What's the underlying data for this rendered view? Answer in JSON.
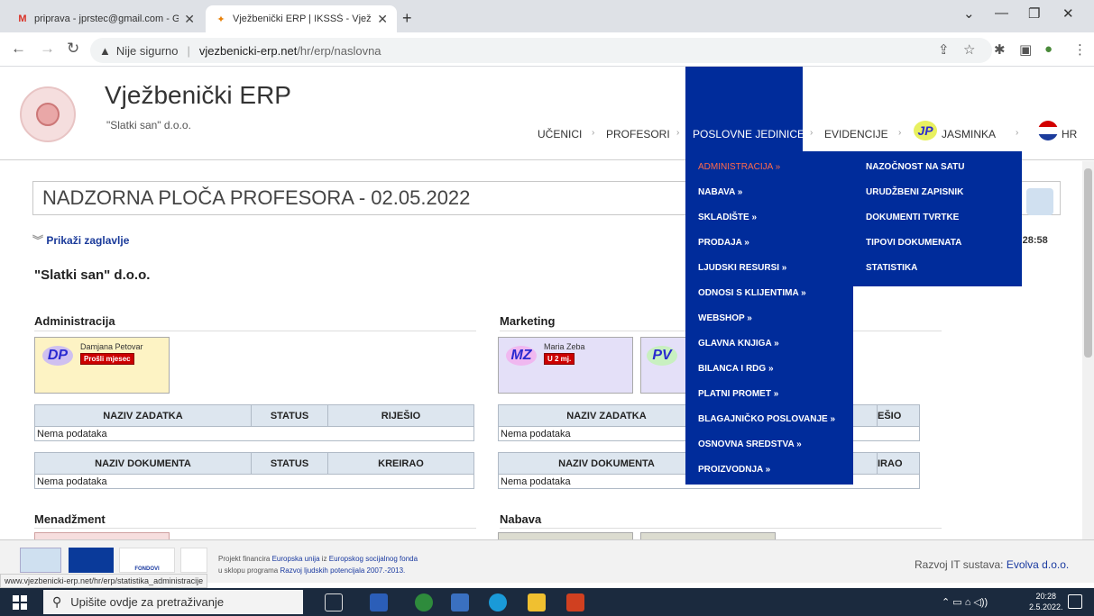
{
  "browser": {
    "tabs": [
      {
        "title": "priprava - jprstec@gmail.com - G",
        "favicon": "gmail-icon"
      },
      {
        "title": "Vježbenički ERP | IKSSŠ - Vježbe",
        "favicon": "erp-favicon"
      }
    ],
    "security_label": "Nije sigurno",
    "url_host": "vjezbenicki-erp.net",
    "url_path": "/hr/erp/naslovna"
  },
  "site": {
    "title": "Vježbenički ERP",
    "subtitle": "\"Slatki san\" d.o.o.",
    "nav": [
      "UČENICI",
      "PROFESORI",
      "POSLOVNE JEDINICE",
      "EVIDENCIJE",
      "JASMINKA",
      "HR"
    ],
    "user_initials": "JP"
  },
  "dashboard": {
    "title": "NADZORNA PLOČA PROFESORA - 02.05.2022",
    "show_header": "Prikaži zaglavlje",
    "company": "\"Slatki san\" d.o.o.",
    "time": ":28:58"
  },
  "sections": {
    "administracija": {
      "title": "Administracija",
      "user": {
        "initials": "DP",
        "name": "Damjana Petovar",
        "badge": "Prošli mjesec"
      }
    },
    "marketing": {
      "title": "Marketing",
      "user": {
        "initials": "MZ",
        "name": "Maria Zeba",
        "badge": "U 2 mj."
      },
      "user2": {
        "initials": "PV"
      }
    },
    "menadzment": {
      "title": "Menadžment"
    },
    "nabava": {
      "title": "Nabava"
    }
  },
  "tables": {
    "tasks_headers": [
      "NAZIV ZADATKA",
      "STATUS",
      "RIJEŠIO"
    ],
    "docs_headers": [
      "NAZIV DOKUMENTA",
      "STATUS",
      "KREIRAO"
    ],
    "tasks_headers_partial": [
      "NAZIV ZADATKA",
      "EŠIO"
    ],
    "docs_headers_partial": [
      "NAZIV DOKUMENTA",
      "IRAO"
    ],
    "empty": "Nema podataka"
  },
  "menu": {
    "items": [
      "ADMINISTRACIJA »",
      "NABAVA »",
      "SKLADIŠTE »",
      "PRODAJA »",
      "LJUDSKI RESURSI »",
      "ODNOSI S KLIJENTIMA »",
      "WEBSHOP »",
      "GLAVNA KNJIGA »",
      "BILANCA I RDG »",
      "PLATNI PROMET »",
      "BLAGAJNIČKO POSLOVANJE »",
      "OSNOVNA SREDSTVA »",
      "PROIZVODNJA »"
    ],
    "submenu": [
      "NAZOČNOST NA SATU",
      "URUDŽBENI ZAPISNIK",
      "DOKUMENTI TVRTKE",
      "TIPOVI DOKUMENATA",
      "STATISTIKA"
    ]
  },
  "footer": {
    "line1_pre": "Projekt financira ",
    "line1_eu": "Europska unija",
    "line1_mid": " iz ",
    "line1_fund": "Europskog socijalnog fonda",
    "line2_pre": "u sklopu programa ",
    "line2_prog": "Razvoj ljudskih potencijala 2007.-2013.",
    "fondovi": "FONDOVI",
    "status_url": "www.vjezbenicki-erp.net/hr/erp/statistika_administracije",
    "dev_label": "Razvoj IT sustava: ",
    "dev_link": "Evolva d.o.o."
  },
  "taskbar": {
    "search_placeholder": "Upišite ovdje za pretraživanje",
    "time": "20:28",
    "date": "2.5.2022."
  },
  "colors": {
    "menu_bg": "#002c9b",
    "menu_active": "#ff6a4a",
    "badge_red": "#cc0000"
  }
}
